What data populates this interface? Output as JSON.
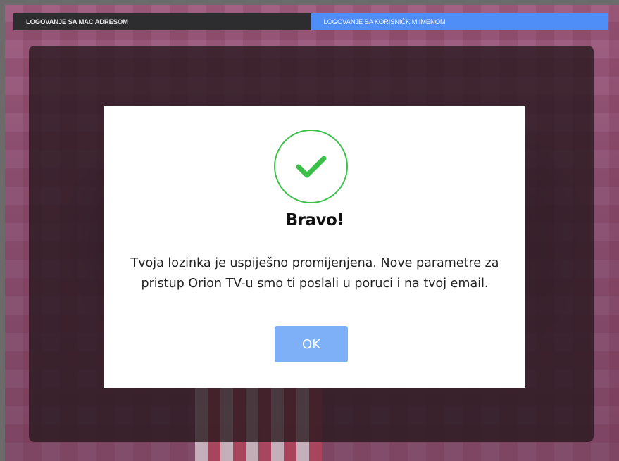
{
  "tabs": {
    "mac_label": "LOGOVANJE SA MAC ADRESOM",
    "user_label": "LOGOVANJE SA KORISNIČKIM IMENOM"
  },
  "modal": {
    "icon": "check-icon",
    "title": "Bravo!",
    "message": "Tvoja lozinka je uspiješno promijenjena. Nove parametre za pristup Orion TV-u smo ti poslali u poruci i na tvoj email.",
    "ok_label": "OK"
  },
  "colors": {
    "active_tab": "#4f8ef7",
    "inactive_tab": "#2d2d2f",
    "success": "#3bc14a",
    "ok_button": "#7eb0f7"
  }
}
